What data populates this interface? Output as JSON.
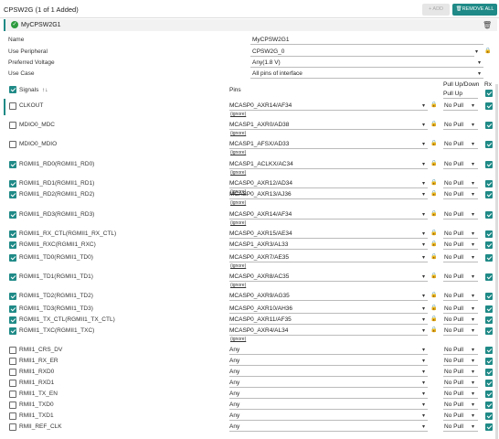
{
  "header": {
    "title": "CPSW2G (1 of 1 Added)",
    "add_label": "+ ADD",
    "remove_all_label": "REMOVE ALL"
  },
  "instance": {
    "name": "MyCPSW2G1"
  },
  "props": [
    {
      "label": "Name",
      "value": "MyCPSW2G1"
    },
    {
      "label": "Use Peripheral",
      "value": "CPSW2G_0"
    },
    {
      "label": "Preferred Voltage",
      "value": "Any(1.8 V)"
    },
    {
      "label": "Use Case",
      "value": "All pins of interface"
    }
  ],
  "table": {
    "signals_label": "Signals",
    "sort_icon": "↑↓",
    "pins_label": "Pins",
    "pull_label": "Pull Up/Down",
    "pull_header_value": "Pull Up",
    "rx_label": "Rx",
    "ignore_label": "(ignore)"
  },
  "rows": [
    {
      "signal": "CLKOUT",
      "checked": false,
      "pin": "MCASP0_AXR14/AF34",
      "ignore": true,
      "pull": "No Pull",
      "rx": true
    },
    {
      "signal": "MDIO0_MDC",
      "checked": false,
      "pin": "MCASP1_AXR0/AD38",
      "ignore": true,
      "pull": "No Pull",
      "rx": true
    },
    {
      "signal": "MDIO0_MDIO",
      "checked": false,
      "pin": "MCASP1_AFSX/AD33",
      "ignore": true,
      "pull": "No Pull",
      "rx": true
    },
    {
      "signal": "RGMII1_RD0(RGMII1_RD0)",
      "checked": true,
      "pin": "MCASP1_ACLKX/AC34",
      "ignore": true,
      "pull": "No Pull",
      "rx": true
    },
    {
      "signal": "RGMII1_RD1(RGMII1_RD1)",
      "checked": true,
      "pin": "MCASP0_AXR12/AD34",
      "ignore": true,
      "pull": "No Pull",
      "rx": true
    },
    {
      "signal": "RGMII1_RD2(RGMII1_RD2)",
      "checked": true,
      "pin": "MCASP0_AXR13/AJ36",
      "ignore": true,
      "pull": "No Pull",
      "rx": true
    },
    {
      "signal": "RGMII1_RD3(RGMII1_RD3)",
      "checked": true,
      "pin": "MCASP0_AXR14/AF34",
      "ignore": true,
      "pull": "No Pull",
      "rx": true
    },
    {
      "signal": "RGMII1_RX_CTL(RGMII1_RX_CTL)",
      "checked": true,
      "pin": "MCASP0_AXR15/AE34",
      "ignore": false,
      "pull": "No Pull",
      "rx": true
    },
    {
      "signal": "RGMII1_RXC(RGMII1_RXC)",
      "checked": true,
      "pin": "MCASP1_AXR3/AL33",
      "ignore": false,
      "pull": "No Pull",
      "rx": true
    },
    {
      "signal": "RGMII1_TD0(RGMII1_TD0)",
      "checked": true,
      "pin": "MCASP0_AXR7/AE35",
      "ignore": true,
      "pull": "No Pull",
      "rx": true
    },
    {
      "signal": "RGMII1_TD1(RGMII1_TD1)",
      "checked": true,
      "pin": "MCASP0_AXR8/AC35",
      "ignore": true,
      "pull": "No Pull",
      "rx": true
    },
    {
      "signal": "RGMII1_TD2(RGMII1_TD2)",
      "checked": true,
      "pin": "MCASP0_AXR9/AG35",
      "ignore": false,
      "pull": "No Pull",
      "rx": true
    },
    {
      "signal": "RGMII1_TD3(RGMII1_TD3)",
      "checked": true,
      "pin": "MCASP0_AXR10/AH36",
      "ignore": false,
      "pull": "No Pull",
      "rx": true
    },
    {
      "signal": "RGMII1_TX_CTL(RGMII1_TX_CTL)",
      "checked": true,
      "pin": "MCASP0_AXR11/AF35",
      "ignore": false,
      "pull": "No Pull",
      "rx": true
    },
    {
      "signal": "RGMII1_TXC(RGMII1_TXC)",
      "checked": true,
      "pin": "MCASP0_AXR4/AL34",
      "ignore": true,
      "pull": "No Pull",
      "rx": true
    },
    {
      "signal": "RMII1_CRS_DV",
      "checked": false,
      "pin": "Any",
      "ignore": false,
      "pull": "No Pull",
      "rx": true
    },
    {
      "signal": "RMII1_RX_ER",
      "checked": false,
      "pin": "Any",
      "ignore": false,
      "pull": "No Pull",
      "rx": true
    },
    {
      "signal": "RMII1_RXD0",
      "checked": false,
      "pin": "Any",
      "ignore": false,
      "pull": "No Pull",
      "rx": true
    },
    {
      "signal": "RMII1_RXD1",
      "checked": false,
      "pin": "Any",
      "ignore": false,
      "pull": "No Pull",
      "rx": true
    },
    {
      "signal": "RMII1_TX_EN",
      "checked": false,
      "pin": "Any",
      "ignore": false,
      "pull": "No Pull",
      "rx": true
    },
    {
      "signal": "RMII1_TXD0",
      "checked": false,
      "pin": "Any",
      "ignore": false,
      "pull": "No Pull",
      "rx": true
    },
    {
      "signal": "RMII1_TXD1",
      "checked": false,
      "pin": "Any",
      "ignore": false,
      "pull": "No Pull",
      "rx": true
    },
    {
      "signal": "RMII_REF_CLK",
      "checked": false,
      "pin": "Any",
      "ignore": false,
      "pull": "No Pull",
      "rx": true
    }
  ],
  "colors": {
    "accent": "#1f8a87",
    "check_green": "#2d9a3e"
  }
}
